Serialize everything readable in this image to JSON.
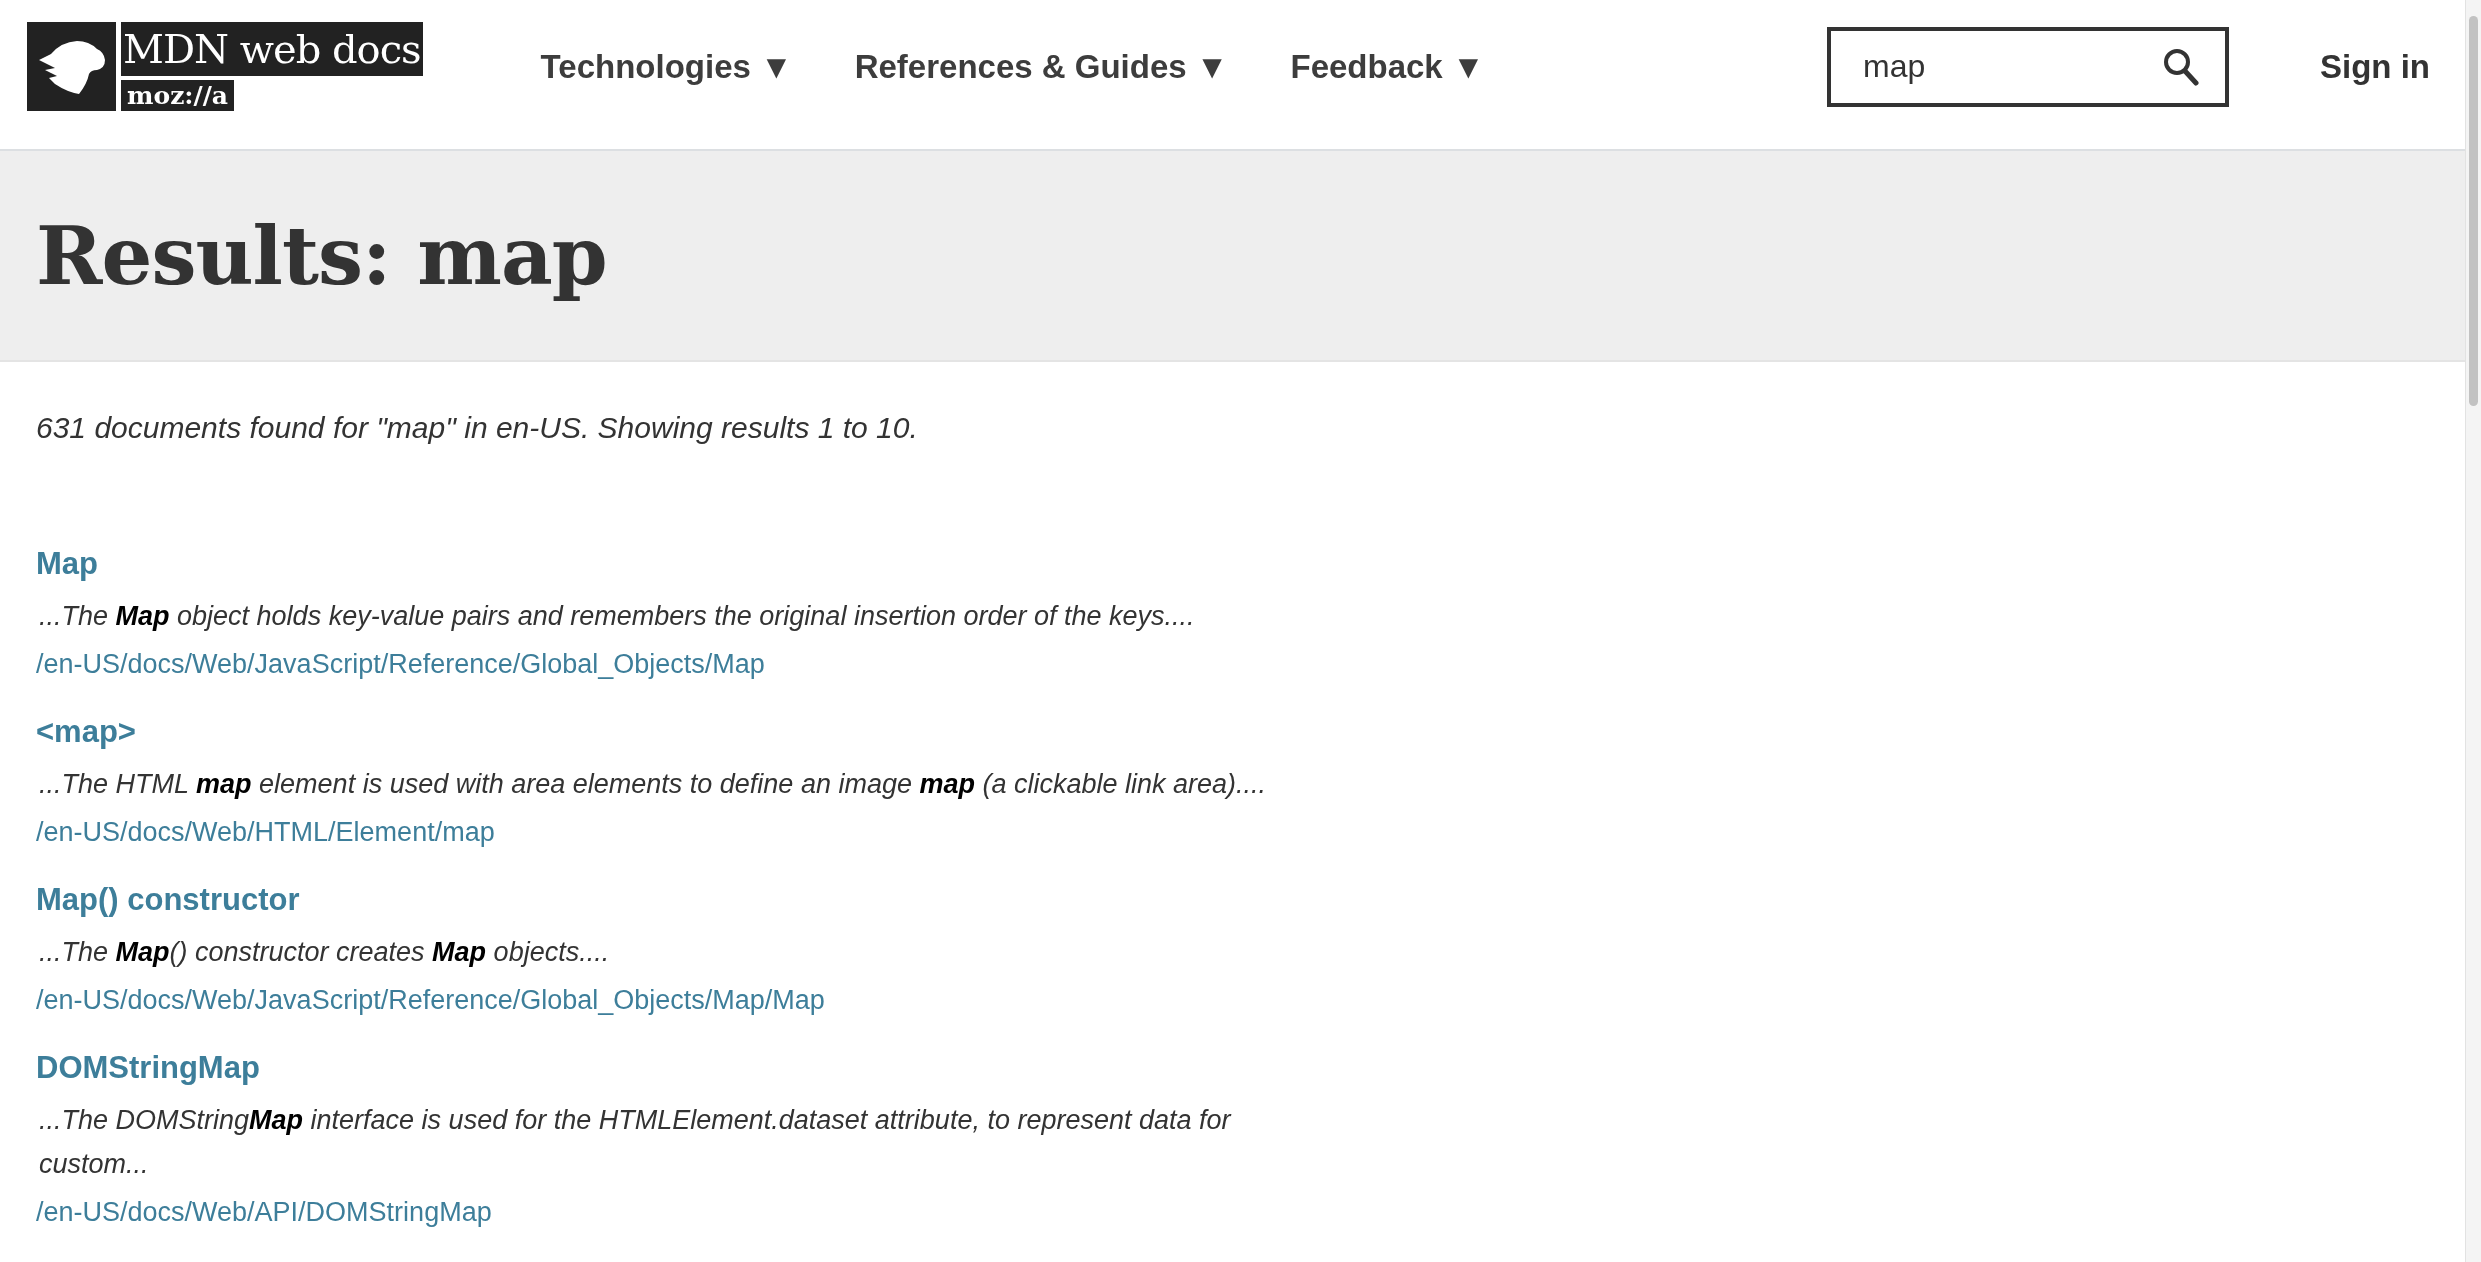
{
  "header": {
    "logo": {
      "wordmark": "MDN web docs",
      "sub": "moz://a"
    },
    "nav": [
      {
        "label": "Technologies",
        "caret": "▼"
      },
      {
        "label": "References & Guides",
        "caret": "▼"
      },
      {
        "label": "Feedback",
        "caret": "▼"
      }
    ],
    "search": {
      "value": "map"
    },
    "sign_in": "Sign in"
  },
  "hero": {
    "title": "Results: map"
  },
  "summary": "631 documents found for \"map\" in en-US. Showing results 1 to 10.",
  "results": [
    {
      "title": "Map",
      "excerpt": "...The **Map** object holds key-value pairs and remembers the original insertion order of the keys....",
      "url": "/en-US/docs/Web/JavaScript/Reference/Global_Objects/Map"
    },
    {
      "title": "<map>",
      "excerpt": "...The HTML **map** element is used with area elements to define an image **map** (a clickable link area)....",
      "url": "/en-US/docs/Web/HTML/Element/map"
    },
    {
      "title": "Map() constructor",
      "excerpt": "...The **Map**() constructor creates **Map** objects....",
      "url": "/en-US/docs/Web/JavaScript/Reference/Global_Objects/Map/Map"
    },
    {
      "title": "DOMStringMap",
      "excerpt": "...The DOMString**Map** interface is used for the HTMLElement.dataset attribute, to represent data for custom...",
      "url": "/en-US/docs/Web/API/DOMStringMap"
    }
  ]
}
